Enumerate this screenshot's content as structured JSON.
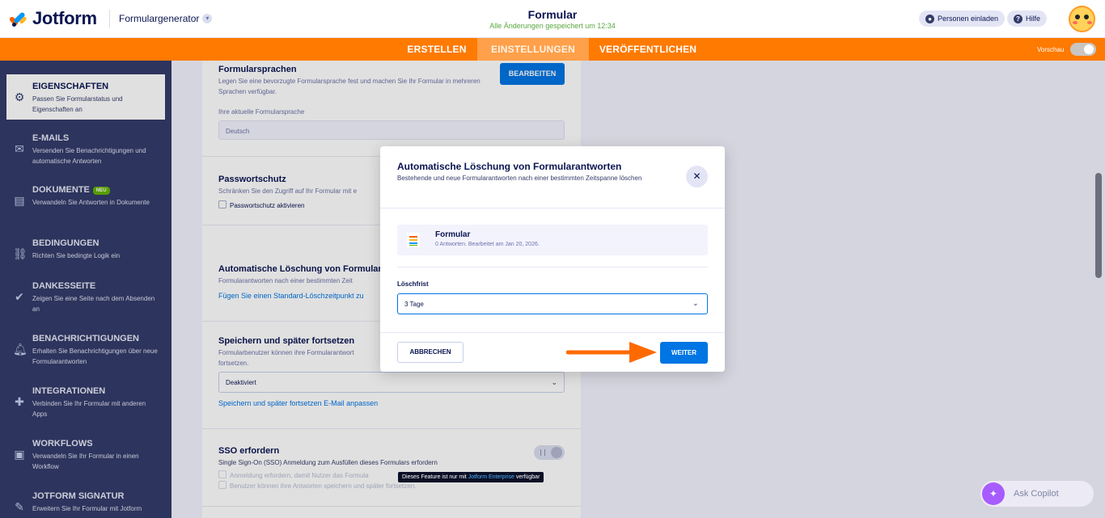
{
  "header": {
    "logo_text": "Jotform",
    "builder_label": "Formulargenerator",
    "form_title": "Formular",
    "saved_status": "Alle Änderungen gespeichert um 12:34",
    "invite_label": "Personen einladen",
    "help_label": "Hilfe"
  },
  "nav": {
    "tabs": [
      {
        "label": "ERSTELLEN"
      },
      {
        "label": "EINSTELLUNGEN"
      },
      {
        "label": "VERÖFFENTLICHEN"
      }
    ],
    "preview_label": "Vorschau"
  },
  "sidebar": {
    "items": [
      {
        "title": "EIGENSCHAFTEN",
        "desc": "Passen Sie Formularstatus und Eigenschaften an",
        "icon": "gear-icon"
      },
      {
        "title": "E-MAILS",
        "desc": "Versenden Sie Benachrichtigungen und automatische Antworten",
        "icon": "envelope-icon"
      },
      {
        "title": "DOKUMENTE",
        "badge": "NEU",
        "desc": "Verwandeln Sie Antworten in Dokumente",
        "icon": "document-icon"
      },
      {
        "title": "BEDINGUNGEN",
        "desc": "Richten Sie bedingte Logik ein",
        "icon": "sitemap-icon"
      },
      {
        "title": "DANKESSEITE",
        "desc": "Zeigen Sie eine Seite nach dem Absenden an",
        "icon": "check-circle-icon"
      },
      {
        "title": "BENACHRICHTIGUNGEN",
        "desc": "Erhalten Sie Benachrichtigungen über neue Formularantworten",
        "icon": "bell-icon"
      },
      {
        "title": "INTEGRATIONEN",
        "desc": "Verbinden Sie Ihr Formular mit anderen Apps",
        "icon": "puzzle-icon"
      },
      {
        "title": "WORKFLOWS",
        "desc": "Verwandeln Sie Ihr Formular in einen Workflow",
        "icon": "workflow-icon"
      },
      {
        "title": "JOTFORM SIGNATUR",
        "desc": "Erweitern Sie Ihr Formular mit Jotform",
        "icon": "signature-icon"
      }
    ]
  },
  "settings": {
    "languages": {
      "title": "Formularsprachen",
      "desc": "Legen Sie eine bevorzugte Formularsprache fest und machen Sie Ihr Formular in mehreren Sprachen verfügbar.",
      "button": "BEARBEITEN",
      "current_label": "Ihre aktuelle Formularsprache",
      "current_value": "Deutsch"
    },
    "password": {
      "title": "Passwortschutz",
      "desc": "Schränken Sie den Zugriff auf Ihr Formular mit e",
      "checkbox": "Passwortschutz aktivieren"
    },
    "autodelete": {
      "title": "Automatische Löschung von Formularan",
      "desc": "Formularantworten nach einer bestimmten Zeit",
      "link": "Fügen Sie einen Standard-Löschzeitpunkt zu"
    },
    "save_later": {
      "title": "Speichern und später fortsetzen",
      "desc": "Formularbenutzer können ihre Formularantwort fortsetzen.",
      "value": "Deaktiviert",
      "link": "Speichern und später fortsetzen E-Mail anpassen"
    },
    "sso": {
      "title": "SSO erfordern",
      "desc": "Single Sign-On (SSO) Anmeldung zum Ausfüllen dieses Formulars erfordern",
      "opt1": "Anmeldung erfordern, damit Nutzer das Formula",
      "opt2": "Benutzer können ihre Antworten speichern und später fortsetzen."
    }
  },
  "tooltip": {
    "prefix": "Dieses Feature ist nur mit ",
    "link": "Jotform Enterprise",
    "suffix": " verfügbar"
  },
  "copilot": {
    "label": "Ask Copilot"
  },
  "modal": {
    "title": "Automatische Löschung von Formularantworten",
    "subtitle": "Bestehende und neue Formularantworten nach einer bestimmten Zeitspanne löschen",
    "form_name": "Formular",
    "form_meta": "0 Antworten. Bearbeitet am Jan 20, 2026.",
    "field_label": "Löschfrist",
    "field_value": "3 Tage",
    "cancel_label": "ABBRECHEN",
    "next_label": "WEITER"
  },
  "colors": {
    "accent": "#0075e3",
    "nav_orange": "#ff7a00",
    "sidebar_bg": "#343c6a",
    "arrow": "#ff6a00"
  }
}
